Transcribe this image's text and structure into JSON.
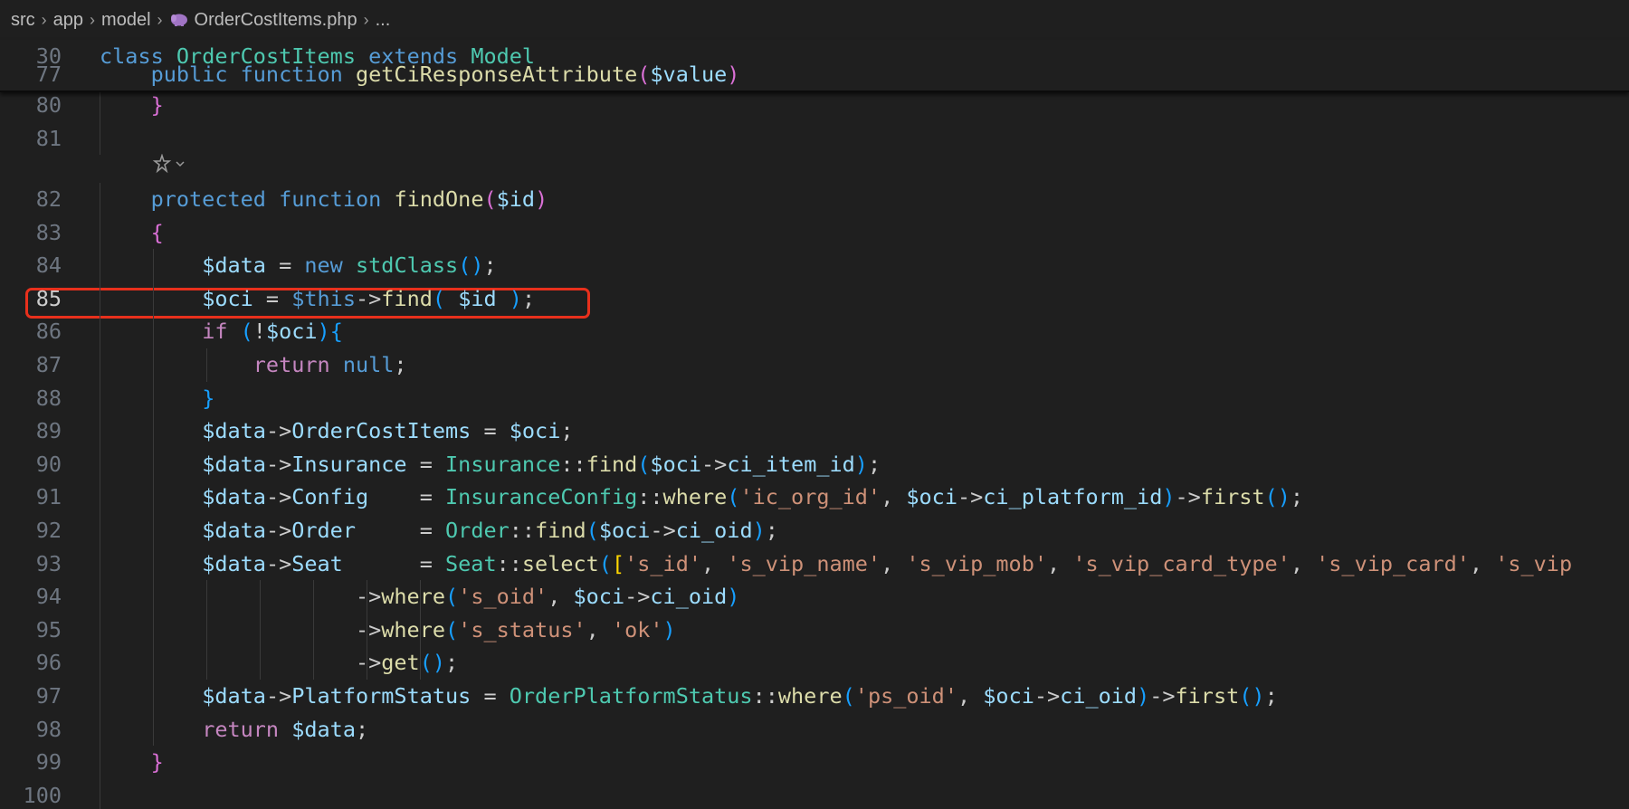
{
  "breadcrumb": {
    "parts": [
      "src",
      "app",
      "model"
    ],
    "file": "OrderCostItems.php",
    "ellipsis": "..."
  },
  "sticky": [
    {
      "n": "30",
      "html": "<span class=\"k\">class</span> <span class=\"c\">OrderCostItems</span> <span class=\"k\">extends</span> <span class=\"c\">Model</span>"
    },
    {
      "n": "77",
      "html": "    <span class=\"k\">public</span> <span class=\"k\">function</span> <span class=\"f\">getCiResponseAttribute</span><span class=\"b2\">(</span><span class=\"v\">$value</span><span class=\"b2\">)</span>"
    }
  ],
  "lines": [
    {
      "n": "80",
      "html": "    <span class=\"b2\">}</span>"
    },
    {
      "n": "81",
      "html": ""
    },
    {
      "n": "82",
      "html": "    <span class=\"k\">protected</span> <span class=\"k\">function</span> <span class=\"f\">findOne</span><span class=\"b2\">(</span><span class=\"v\">$id</span><span class=\"b2\">)</span>"
    },
    {
      "n": "83",
      "html": "    <span class=\"b2\">{</span>"
    },
    {
      "n": "84",
      "html": "        <span class=\"v\">$data</span> = <span class=\"k\">new</span> <span class=\"c\">stdClass</span><span class=\"b3\">()</span>;"
    },
    {
      "n": "85",
      "html": "        <span class=\"v\">$oci</span> = <span class=\"k\">$this</span>-&gt;<span class=\"f\">find</span><span class=\"b3\">(</span> <span class=\"v\">$id</span> <span class=\"b3\">)</span>;"
    },
    {
      "n": "86",
      "html": "        <span class=\"ctl\">if</span> <span class=\"b3\">(</span>!<span class=\"v\">$oci</span><span class=\"b3\">){</span>"
    },
    {
      "n": "87",
      "html": "            <span class=\"ctl\">return</span> <span class=\"k\">null</span>;"
    },
    {
      "n": "88",
      "html": "        <span class=\"b3\">}</span>"
    },
    {
      "n": "89",
      "html": "        <span class=\"v\">$data</span>-&gt;<span class=\"v\">OrderCostItems</span> = <span class=\"v\">$oci</span>;"
    },
    {
      "n": "90",
      "html": "        <span class=\"v\">$data</span>-&gt;<span class=\"v\">Insurance</span> = <span class=\"c\">Insurance</span>::<span class=\"f\">find</span><span class=\"b3\">(</span><span class=\"v\">$oci</span>-&gt;<span class=\"v\">ci_item_id</span><span class=\"b3\">)</span>;"
    },
    {
      "n": "91",
      "html": "        <span class=\"v\">$data</span>-&gt;<span class=\"v\">Config</span>    = <span class=\"c\">InsuranceConfig</span>::<span class=\"f\">where</span><span class=\"b3\">(</span><span class=\"s\">'ic_org_id'</span>, <span class=\"v\">$oci</span>-&gt;<span class=\"v\">ci_platform_id</span><span class=\"b3\">)</span>-&gt;<span class=\"f\">first</span><span class=\"b3\">()</span>;"
    },
    {
      "n": "92",
      "html": "        <span class=\"v\">$data</span>-&gt;<span class=\"v\">Order</span>     = <span class=\"c\">Order</span>::<span class=\"f\">find</span><span class=\"b3\">(</span><span class=\"v\">$oci</span>-&gt;<span class=\"v\">ci_oid</span><span class=\"b3\">)</span>;"
    },
    {
      "n": "93",
      "html": "        <span class=\"v\">$data</span>-&gt;<span class=\"v\">Seat</span>      = <span class=\"c\">Seat</span>::<span class=\"f\">select</span><span class=\"b3\">(</span><span class=\"b1\">[</span><span class=\"s\">'s_id'</span>, <span class=\"s\">'s_vip_name'</span>, <span class=\"s\">'s_vip_mob'</span>, <span class=\"s\">'s_vip_card_type'</span>, <span class=\"s\">'s_vip_card'</span>, <span class=\"s\">'s_vip</span>"
    },
    {
      "n": "94",
      "html": "                    -&gt;<span class=\"f\">where</span><span class=\"b3\">(</span><span class=\"s\">'s_oid'</span>, <span class=\"v\">$oci</span>-&gt;<span class=\"v\">ci_oid</span><span class=\"b3\">)</span>"
    },
    {
      "n": "95",
      "html": "                    -&gt;<span class=\"f\">where</span><span class=\"b3\">(</span><span class=\"s\">'s_status'</span>, <span class=\"s\">'ok'</span><span class=\"b3\">)</span>"
    },
    {
      "n": "96",
      "html": "                    -&gt;<span class=\"f\">get</span><span class=\"b3\">()</span>;"
    },
    {
      "n": "97",
      "html": "        <span class=\"v\">$data</span>-&gt;<span class=\"v\">PlatformStatus</span> = <span class=\"c\">OrderPlatformStatus</span>::<span class=\"f\">where</span><span class=\"b3\">(</span><span class=\"s\">'ps_oid'</span>, <span class=\"v\">$oci</span>-&gt;<span class=\"v\">ci_oid</span><span class=\"b3\">)</span>-&gt;<span class=\"f\">first</span><span class=\"b3\">()</span>;"
    },
    {
      "n": "98",
      "html": "        <span class=\"ctl\">return</span> <span class=\"v\">$data</span>;"
    },
    {
      "n": "99",
      "html": "    <span class=\"b2\">}</span>"
    },
    {
      "n": "100",
      "html": ""
    }
  ],
  "highlight": {
    "line": "85",
    "color": "#e8301c"
  },
  "codelens": {
    "icon": "copilot-sparkle-icon",
    "chevron": "chevron-down-icon"
  }
}
